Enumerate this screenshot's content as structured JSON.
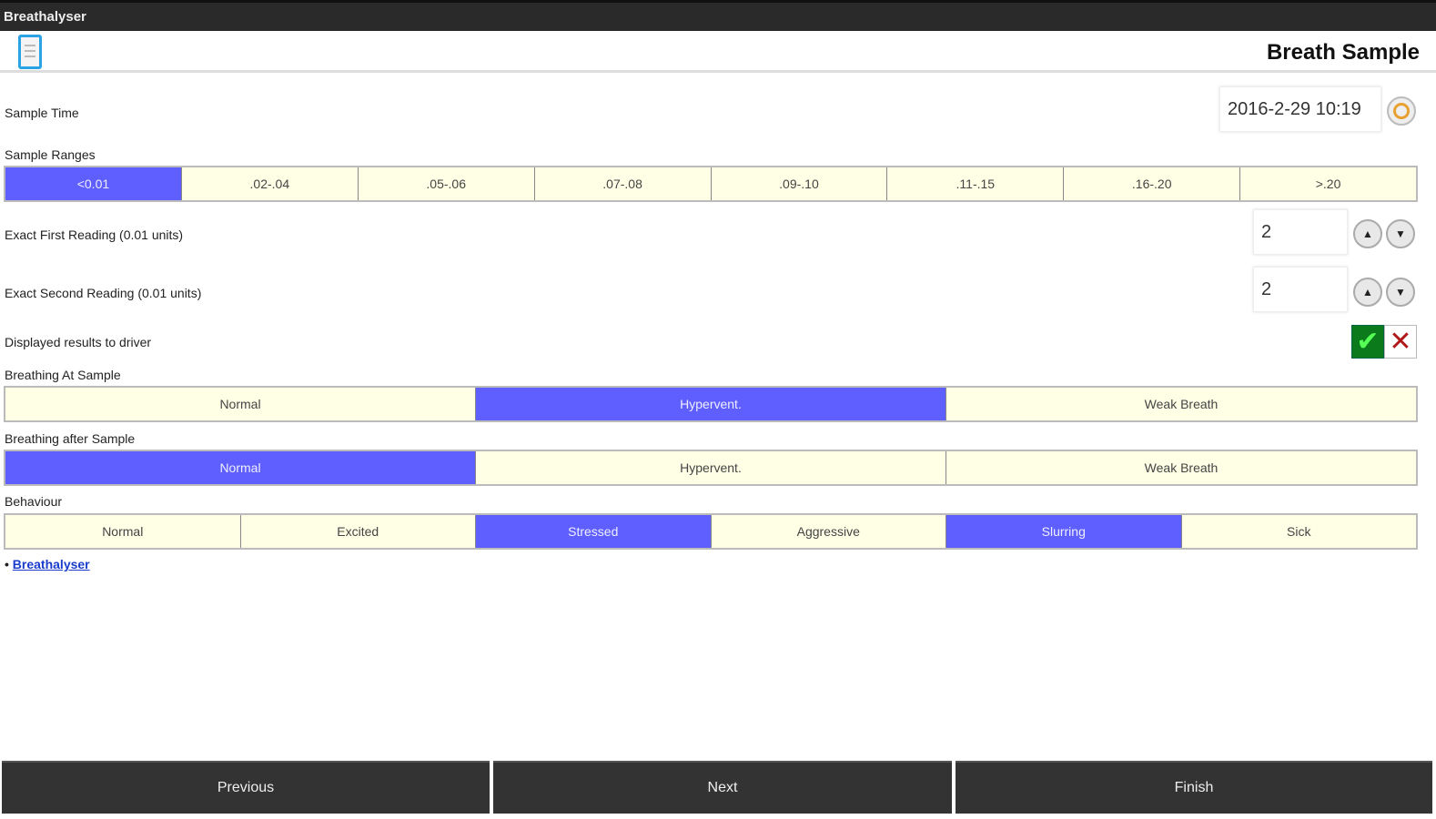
{
  "app_title": "Breathalyser",
  "page_title": "Breath Sample",
  "sample_time": {
    "label": "Sample Time",
    "value": "2016-2-29 10:19"
  },
  "sample_ranges": {
    "label": "Sample Ranges",
    "options": [
      "<0.01",
      ".02-.04",
      ".05-.06",
      ".07-.08",
      ".09-.10",
      ".11-.15",
      ".16-.20",
      ">.20"
    ],
    "selected": [
      0
    ]
  },
  "first_reading": {
    "label": "Exact First Reading (0.01 units)",
    "value": "2"
  },
  "second_reading": {
    "label": "Exact Second Reading (0.01 units)",
    "value": "2"
  },
  "displayed_results": {
    "label": "Displayed results to driver",
    "value": true
  },
  "breathing_at": {
    "label": "Breathing At Sample",
    "options": [
      "Normal",
      "Hypervent.",
      "Weak Breath"
    ],
    "selected": [
      1
    ]
  },
  "breathing_after": {
    "label": "Breathing after Sample",
    "options": [
      "Normal",
      "Hypervent.",
      "Weak Breath"
    ],
    "selected": [
      0
    ]
  },
  "behaviour": {
    "label": "Behaviour",
    "options": [
      "Normal",
      "Excited",
      "Stressed",
      "Aggressive",
      "Slurring",
      "Sick"
    ],
    "selected": [
      2,
      4
    ]
  },
  "breadcrumb": {
    "bullet": "•",
    "link": "Breathalyser"
  },
  "footer": {
    "previous": "Previous",
    "next": "Next",
    "finish": "Finish"
  },
  "colors": {
    "selected": "#5f5fff",
    "unselected": "#ffffe6",
    "check_green": "#0a7a1a"
  }
}
